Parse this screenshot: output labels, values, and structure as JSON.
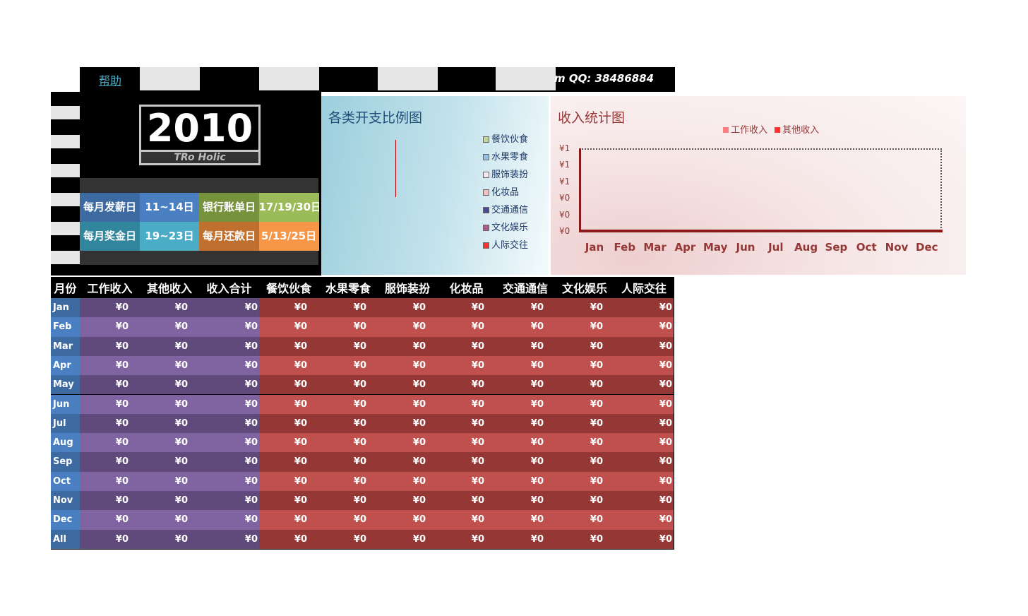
{
  "topbar": {
    "help": "帮助",
    "qq_label": "m  QQ:",
    "qq_number": "38486884"
  },
  "calendar": {
    "year": "2010",
    "brand": "TRo Holic",
    "rows": [
      [
        {
          "text": "每月发薪日",
          "color": "#3d6aa0"
        },
        {
          "text": "11~14日",
          "color": "#4a7fc1"
        },
        {
          "text": "银行账单日",
          "color": "#76923c"
        },
        {
          "text": "17/19/30日",
          "color": "#9bbb59"
        }
      ],
      [
        {
          "text": "每月奖金日",
          "color": "#31859c"
        },
        {
          "text": "19~23日",
          "color": "#4bacc6"
        },
        {
          "text": "每月还款日",
          "color": "#c0702e"
        },
        {
          "text": "5/13/25日",
          "color": "#f79646"
        }
      ]
    ]
  },
  "pie_chart": {
    "title": "各类开支比例图",
    "legend": [
      {
        "label": "餐饮伙食",
        "color": "#c3d69b"
      },
      {
        "label": "水果零食",
        "color": "#8ec3e8"
      },
      {
        "label": "服饰装扮",
        "color": "#f2e8f2"
      },
      {
        "label": "化妆品",
        "color": "#f0c0c0"
      },
      {
        "label": "交通通信",
        "color": "#4a4a9c"
      },
      {
        "label": "文化娱乐",
        "color": "#b05a8c"
      },
      {
        "label": "人际交往",
        "color": "#ff3030"
      }
    ]
  },
  "chart_data": {
    "type": "bar",
    "title": "收入统计图",
    "categories": [
      "Jan",
      "Feb",
      "Mar",
      "Apr",
      "May",
      "Jun",
      "Jul",
      "Aug",
      "Sep",
      "Oct",
      "Nov",
      "Dec"
    ],
    "series": [
      {
        "name": "工作收入",
        "values": [
          0,
          0,
          0,
          0,
          0,
          0,
          0,
          0,
          0,
          0,
          0,
          0
        ],
        "color": "#ff7c80"
      },
      {
        "name": "其他收入",
        "values": [
          0,
          0,
          0,
          0,
          0,
          0,
          0,
          0,
          0,
          0,
          0,
          0
        ],
        "color": "#ff3333"
      }
    ],
    "yticks": [
      "¥1",
      "¥1",
      "¥1",
      "¥0",
      "¥0",
      "¥0"
    ],
    "ylim": [
      0,
      1
    ],
    "legend": "top"
  },
  "table": {
    "headers": [
      "月份",
      "工作收入",
      "其他收入",
      "收入合计",
      "餐饮伙食",
      "水果零食",
      "服饰装扮",
      "化妆品",
      "交通通信",
      "文化娱乐",
      "人际交往"
    ],
    "rows": [
      {
        "month": "Jan",
        "values": [
          "¥0",
          "¥0",
          "¥0",
          "¥0",
          "¥0",
          "¥0",
          "¥0",
          "¥0",
          "¥0",
          "¥0"
        ]
      },
      {
        "month": "Feb",
        "values": [
          "¥0",
          "¥0",
          "¥0",
          "¥0",
          "¥0",
          "¥0",
          "¥0",
          "¥0",
          "¥0",
          "¥0"
        ]
      },
      {
        "month": "Mar",
        "values": [
          "¥0",
          "¥0",
          "¥0",
          "¥0",
          "¥0",
          "¥0",
          "¥0",
          "¥0",
          "¥0",
          "¥0"
        ]
      },
      {
        "month": "Apr",
        "values": [
          "¥0",
          "¥0",
          "¥0",
          "¥0",
          "¥0",
          "¥0",
          "¥0",
          "¥0",
          "¥0",
          "¥0"
        ]
      },
      {
        "month": "May",
        "values": [
          "¥0",
          "¥0",
          "¥0",
          "¥0",
          "¥0",
          "¥0",
          "¥0",
          "¥0",
          "¥0",
          "¥0"
        ]
      },
      {
        "month": "Jun",
        "values": [
          "¥0",
          "¥0",
          "¥0",
          "¥0",
          "¥0",
          "¥0",
          "¥0",
          "¥0",
          "¥0",
          "¥0"
        ]
      },
      {
        "month": "Jul",
        "values": [
          "¥0",
          "¥0",
          "¥0",
          "¥0",
          "¥0",
          "¥0",
          "¥0",
          "¥0",
          "¥0",
          "¥0"
        ]
      },
      {
        "month": "Aug",
        "values": [
          "¥0",
          "¥0",
          "¥0",
          "¥0",
          "¥0",
          "¥0",
          "¥0",
          "¥0",
          "¥0",
          "¥0"
        ]
      },
      {
        "month": "Sep",
        "values": [
          "¥0",
          "¥0",
          "¥0",
          "¥0",
          "¥0",
          "¥0",
          "¥0",
          "¥0",
          "¥0",
          "¥0"
        ]
      },
      {
        "month": "Oct",
        "values": [
          "¥0",
          "¥0",
          "¥0",
          "¥0",
          "¥0",
          "¥0",
          "¥0",
          "¥0",
          "¥0",
          "¥0"
        ]
      },
      {
        "month": "Nov",
        "values": [
          "¥0",
          "¥0",
          "¥0",
          "¥0",
          "¥0",
          "¥0",
          "¥0",
          "¥0",
          "¥0",
          "¥0"
        ]
      },
      {
        "month": "Dec",
        "values": [
          "¥0",
          "¥0",
          "¥0",
          "¥0",
          "¥0",
          "¥0",
          "¥0",
          "¥0",
          "¥0",
          "¥0"
        ]
      },
      {
        "month": "All",
        "values": [
          "¥0",
          "¥0",
          "¥0",
          "¥0",
          "¥0",
          "¥0",
          "¥0",
          "¥0",
          "¥0",
          "¥0"
        ]
      }
    ]
  }
}
